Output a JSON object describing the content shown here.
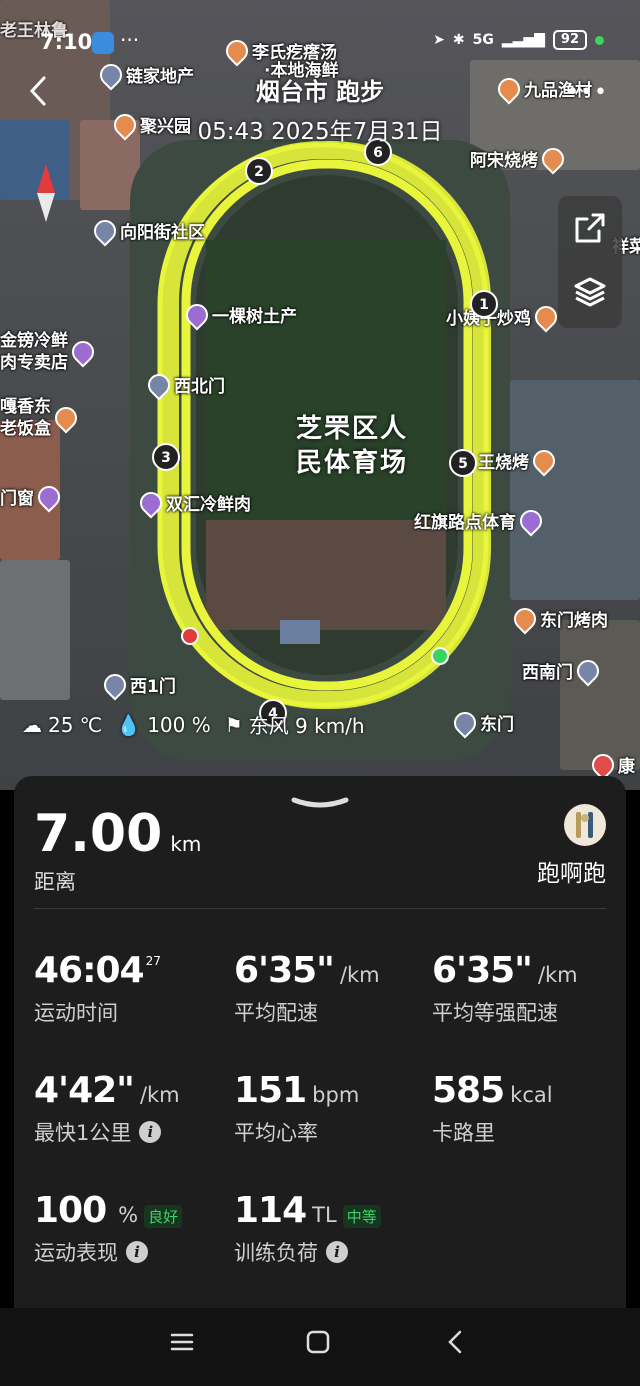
{
  "status_bar": {
    "time": "7:10",
    "network": "5G",
    "battery": "92"
  },
  "header": {
    "back_icon": "chevron-left-icon",
    "title": "烟台市 跑步",
    "datetime": "05:43 2025年7月31日",
    "more_icon": "more-dots-icon"
  },
  "map": {
    "tools": [
      "share-icon",
      "layers-icon"
    ],
    "stadium_label": [
      "芝罘区人",
      "民体育场"
    ],
    "pois": [
      {
        "key": "lianjia",
        "text": "链家地产",
        "kind": "place"
      },
      {
        "key": "li",
        "text": "李氏疙瘩汤",
        "kind": "food"
      },
      {
        "key": "benhai",
        "text": "·本地海鲜",
        "kind": "none"
      },
      {
        "key": "jiupin",
        "text": "九品渔村",
        "kind": "food"
      },
      {
        "key": "juxing",
        "text": "聚兴园",
        "kind": "food"
      },
      {
        "key": "asong",
        "text": "阿宋烧烤",
        "kind": "food"
      },
      {
        "key": "xiangyang",
        "text": "向阳街社区",
        "kind": "place"
      },
      {
        "key": "xiang",
        "text": "祥菜",
        "kind": "none"
      },
      {
        "key": "yikeshu",
        "text": "一棵树土产",
        "kind": "shop"
      },
      {
        "key": "xiaoyizi",
        "text": "小姨子炒鸡",
        "kind": "food"
      },
      {
        "key": "jinbang",
        "text": "金镑冷鲜\n肉专卖店",
        "kind": "shop"
      },
      {
        "key": "xibeimen",
        "text": "西北门",
        "kind": "place"
      },
      {
        "key": "gaxiang",
        "text": "嘎香东\n老饭盒",
        "kind": "food"
      },
      {
        "key": "wangshao",
        "text": "王烧烤",
        "kind": "food"
      },
      {
        "key": "menchuang",
        "text": "门窗",
        "kind": "shop"
      },
      {
        "key": "shuanghui",
        "text": "双汇冷鲜肉",
        "kind": "shop"
      },
      {
        "key": "hongqi",
        "text": "红旗路点体育",
        "kind": "shop"
      },
      {
        "key": "dongmen_bbq",
        "text": "东门烤肉",
        "kind": "food"
      },
      {
        "key": "xinanmen",
        "text": "西南门",
        "kind": "place"
      },
      {
        "key": "xi1men",
        "text": "西1门",
        "kind": "place"
      },
      {
        "key": "dongmen",
        "text": "东门",
        "kind": "place"
      },
      {
        "key": "kang",
        "text": "康",
        "kind": "none"
      },
      {
        "key": "laowang",
        "text": "老王林鲁",
        "kind": "none"
      }
    ],
    "km_markers": [
      "1",
      "2",
      "3",
      "4",
      "5",
      "6"
    ],
    "route_color": "#e8f53a",
    "start_color": "#3bd45e",
    "end_color": "#e23b3b"
  },
  "weather": {
    "temp": "25 ℃",
    "humidity": "100 %",
    "wind": "东风 9 km/h"
  },
  "summary": {
    "distance": "7.00",
    "distance_unit": "km",
    "distance_label": "距离",
    "nickname": "跑啊跑"
  },
  "stats": [
    {
      "value": "46:04",
      "sup": "27",
      "unit": "",
      "label": "运动时间",
      "info": false,
      "badge": ""
    },
    {
      "value": "6'35\"",
      "sup": "",
      "unit": "/km",
      "label": "平均配速",
      "info": false,
      "badge": ""
    },
    {
      "value": "6'35\"",
      "sup": "",
      "unit": "/km",
      "label": "平均等强配速",
      "info": false,
      "badge": ""
    },
    {
      "value": "4'42\"",
      "sup": "",
      "unit": "/km",
      "label": "最快1公里",
      "info": true,
      "badge": ""
    },
    {
      "value": "151",
      "sup": "",
      "unit": "bpm",
      "label": "平均心率",
      "info": false,
      "badge": ""
    },
    {
      "value": "585",
      "sup": "",
      "unit": "kcal",
      "label": "卡路里",
      "info": false,
      "badge": ""
    },
    {
      "value": "100",
      "sup": "",
      "unit": "%",
      "label": "运动表现",
      "info": true,
      "badge": "良好"
    },
    {
      "value": "114",
      "sup": "",
      "unit": "TL",
      "label": "训练负荷",
      "info": true,
      "badge": "中等"
    }
  ],
  "colors": {
    "panel_bg": "#1d1d1d",
    "badge_green": "#3ad26a"
  },
  "navbar": [
    "menu-icon",
    "home-icon",
    "back-icon"
  ]
}
